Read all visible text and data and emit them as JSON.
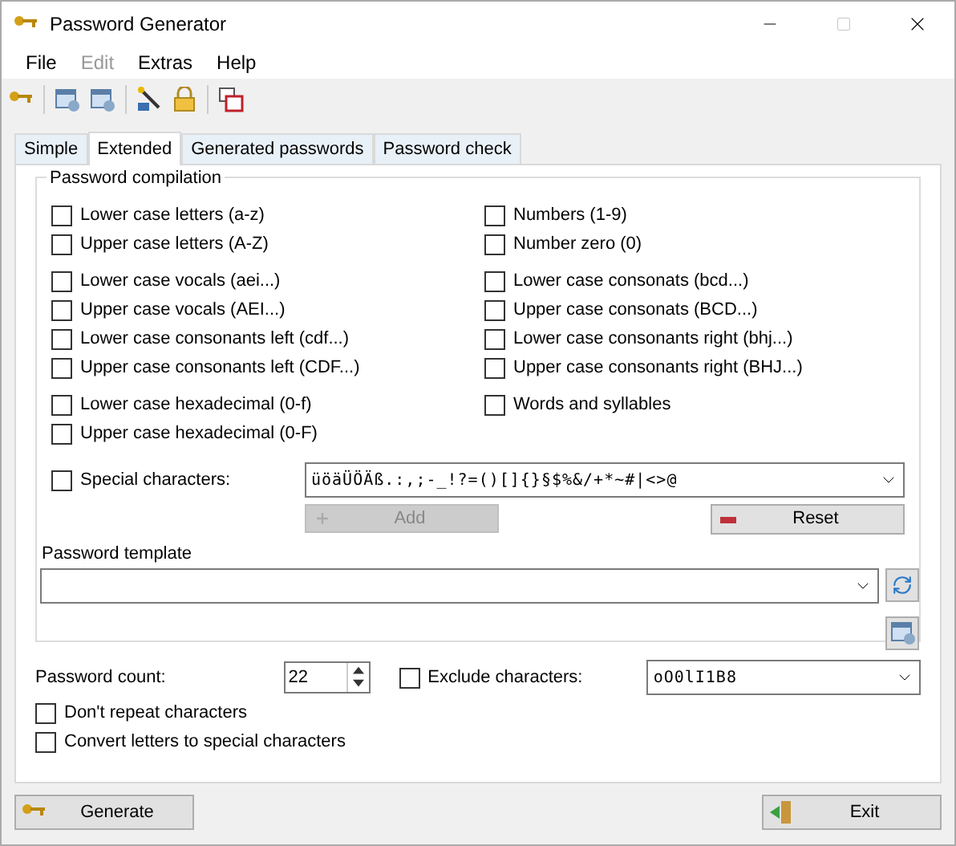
{
  "window": {
    "title": "Password Generator"
  },
  "menu": [
    {
      "label": "File",
      "disabled": false
    },
    {
      "label": "Edit",
      "disabled": true
    },
    {
      "label": "Extras",
      "disabled": false
    },
    {
      "label": "Help",
      "disabled": false
    }
  ],
  "tabs": [
    {
      "label": "Simple",
      "selected": false
    },
    {
      "label": "Extended",
      "selected": true
    },
    {
      "label": "Generated passwords",
      "selected": false
    },
    {
      "label": "Password check",
      "selected": false
    }
  ],
  "compilation": {
    "title": "Password compilation",
    "groups": [
      [
        {
          "label": "Lower case letters (a-z)",
          "checked": false
        },
        {
          "label": "Numbers (1-9)",
          "checked": false
        },
        {
          "label": "Upper case letters (A-Z)",
          "checked": false
        },
        {
          "label": "Number zero (0)",
          "checked": false
        }
      ],
      [
        {
          "label": "Lower case vocals (aei...)",
          "checked": false
        },
        {
          "label": "Lower case consonats (bcd...)",
          "checked": false
        },
        {
          "label": "Upper case vocals (AEI...)",
          "checked": false
        },
        {
          "label": "Upper case consonats (BCD...)",
          "checked": false
        },
        {
          "label": "Lower case consonants left (cdf...)",
          "checked": false
        },
        {
          "label": "Lower case consonants right (bhj...)",
          "checked": false
        },
        {
          "label": "Upper case consonants left (CDF...)",
          "checked": false
        },
        {
          "label": "Upper case consonants right (BHJ...)",
          "checked": false
        }
      ],
      [
        {
          "label": "Lower case hexadecimal (0-f)",
          "checked": false
        },
        {
          "label": "Words and syllables",
          "checked": false
        },
        {
          "label": "Upper case hexadecimal (0-F)",
          "checked": false
        }
      ]
    ],
    "special": {
      "label": "Special characters:",
      "checked": false,
      "value": "üöäÜÖÄß.:,;-_!?=()[]{}§$%&/+*~#|<>@"
    },
    "add_button": {
      "label": "Add",
      "disabled": true
    },
    "reset_button": {
      "label": "Reset",
      "disabled": false
    }
  },
  "template": {
    "title": "Password template"
  },
  "count": {
    "label": "Password count:",
    "value": "22"
  },
  "exclude": {
    "label": "Exclude characters:",
    "checked": false,
    "value": "oO0lI1B8"
  },
  "options": [
    {
      "label": "Don't repeat characters",
      "checked": false
    },
    {
      "label": "Convert letters to special characters",
      "checked": false
    }
  ],
  "buttons": {
    "generate": "Generate",
    "exit": "Exit"
  }
}
